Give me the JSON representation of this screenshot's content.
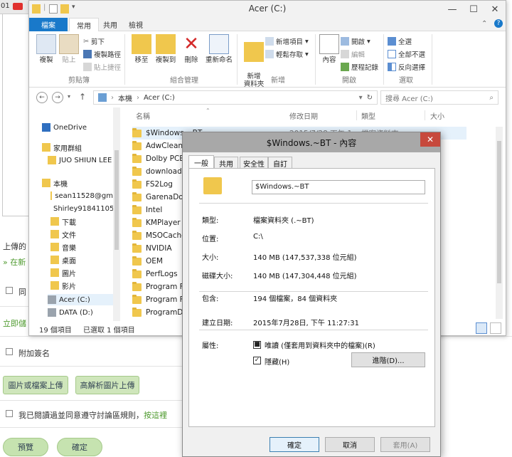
{
  "background_page": {
    "top_left_text": "01",
    "truncated_lines": [
      "上傳的",
      "» 在新",
      "立即儲"
    ],
    "checkbox_same": "同",
    "add_signature": "附加簽名",
    "upload_button": "圖片或檔案上傳",
    "hires_upload_button": "高解析圖片上傳",
    "agree_text": "我已閱讀過並同意遵守討論區規則，",
    "agree_link": "按這裡",
    "preview_button": "預覽",
    "confirm_button": "確定"
  },
  "explorer": {
    "title": "Acer (C:)",
    "ribbon_tabs": [
      "檔案",
      "常用",
      "共用",
      "檢視"
    ],
    "ribbon": {
      "clipboard": {
        "copy": "複製",
        "paste": "貼上",
        "cut": "剪下",
        "copy_path": "複製路徑",
        "paste_shortcut": "貼上捷徑",
        "label": "剪貼簿"
      },
      "organize": {
        "move_to": "移至",
        "copy_to": "複製到",
        "delete": "刪除",
        "rename": "重新命名",
        "label": "組合管理"
      },
      "new": {
        "new_folder": "新增\n資料夾",
        "new_item": "新增項目",
        "easy_access": "輕鬆存取",
        "label": "新增"
      },
      "open": {
        "properties": "內容",
        "open": "開啟",
        "edit": "編輯",
        "history": "歷程記錄",
        "label": "開啟"
      },
      "select": {
        "select_all": "全選",
        "select_none": "全部不選",
        "invert": "反向選擇",
        "label": "選取"
      }
    },
    "address": {
      "path_pc": "本機",
      "path_drive": "Acer (C:)",
      "search_placeholder": "搜尋 Acer (C:)"
    },
    "nav_pane": [
      {
        "label": "OneDrive",
        "icon": "cloud-icon"
      },
      {
        "label": "家用群組",
        "icon": "homegroup-icon"
      },
      {
        "label": "JUO SHIUN LEE",
        "icon": "user-icon"
      },
      {
        "label": "本機",
        "icon": "computer-icon"
      },
      {
        "label": "sean11528@gm",
        "icon": "user-folder-icon"
      },
      {
        "label": "Shirley91841105",
        "icon": "user-folder-icon"
      },
      {
        "label": "下載",
        "icon": "download-icon"
      },
      {
        "label": "文件",
        "icon": "document-icon"
      },
      {
        "label": "音樂",
        "icon": "music-icon"
      },
      {
        "label": "桌面",
        "icon": "desktop-icon"
      },
      {
        "label": "圖片",
        "icon": "picture-icon"
      },
      {
        "label": "影片",
        "icon": "video-icon"
      },
      {
        "label": "Acer (C:)",
        "icon": "drive-icon"
      },
      {
        "label": "DATA (D:)",
        "icon": "drive-icon"
      }
    ],
    "columns": {
      "name": "名稱",
      "modified": "修改日期",
      "type": "類型",
      "size": "大小"
    },
    "files": [
      {
        "name": "$Windows.~BT",
        "date": "2015/7/28 下午 1...",
        "type": "檔案資料夾"
      },
      {
        "name": "AdwCleaner"
      },
      {
        "name": "Dolby PCEE4"
      },
      {
        "name": "download"
      },
      {
        "name": "FS2Log"
      },
      {
        "name": "GarenaDota2"
      },
      {
        "name": "Intel"
      },
      {
        "name": "KMPlayer"
      },
      {
        "name": "MSOCache"
      },
      {
        "name": "NVIDIA"
      },
      {
        "name": "OEM"
      },
      {
        "name": "PerfLogs"
      },
      {
        "name": "Program Files"
      },
      {
        "name": "Program Files (x86)"
      },
      {
        "name": "ProgramData"
      }
    ],
    "status": {
      "count": "19 個項目",
      "selected": "已選取 1 個項目"
    }
  },
  "dialog": {
    "title": "$Windows.~BT - 內容",
    "tabs": [
      "一般",
      "共用",
      "安全性",
      "自訂"
    ],
    "name": "$Windows.~BT",
    "props": [
      {
        "label": "類型:",
        "value": "檔案資料夾 (.~BT)"
      },
      {
        "label": "位置:",
        "value": "C:\\"
      },
      {
        "label": "大小:",
        "value": "140 MB (147,537,338 位元組)"
      },
      {
        "label": "磁碟大小:",
        "value": "140 MB (147,304,448 位元組)"
      },
      {
        "label": "包含:",
        "value": "194 個檔案，84 個資料夾"
      },
      {
        "label": "建立日期:",
        "value": "2015年7月28日, 下午 11:27:31"
      }
    ],
    "attributes_label": "屬性:",
    "readonly_label": "唯讀 (僅套用到資料夾中的檔案)(R)",
    "hidden_label": "隱藏(H)",
    "advanced_button": "進階(D)...",
    "ok_button": "確定",
    "cancel_button": "取消",
    "apply_button": "套用(A)"
  },
  "colors": {
    "file_tab": "#1979ca",
    "folder": "#f0c74d",
    "selection": "#e5f1fb",
    "close_button": "#c7493c",
    "forum_button": "#cfe6bb"
  }
}
